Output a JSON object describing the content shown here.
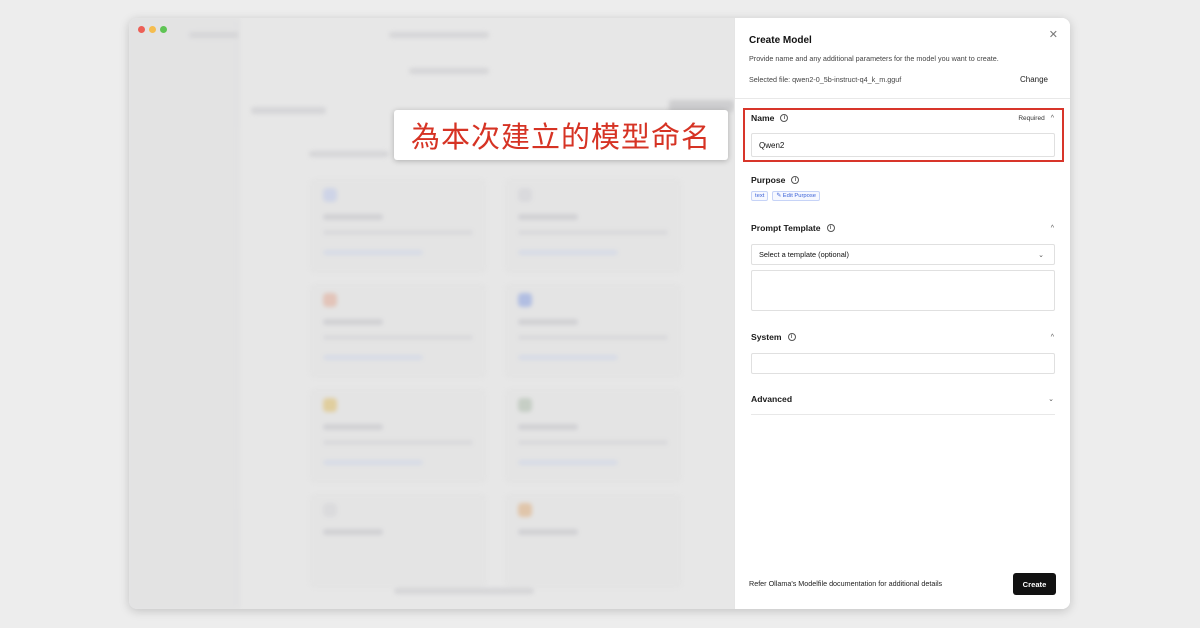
{
  "annotation": {
    "text": "為本次建立的模型命名",
    "color": "#d63324"
  },
  "panel": {
    "title": "Create Model",
    "description": "Provide name and any additional parameters for the model you want to create.",
    "selected_file": "Selected file: qwen2-0_5b-instruct-q4_k_m.gguf",
    "change_label": "Change",
    "close_icon": "close-icon"
  },
  "name_section": {
    "label": "Name",
    "required": "Required",
    "value": "Qwen2"
  },
  "purpose_section": {
    "label": "Purpose",
    "tags": [
      "text",
      "✎ Edit Purpose"
    ]
  },
  "prompt_template": {
    "label": "Prompt Template",
    "select_placeholder": "Select a template (optional)"
  },
  "system_section": {
    "label": "System"
  },
  "advanced_section": {
    "label": "Advanced"
  },
  "footer": {
    "note": "Refer Ollama's Modelfile documentation for additional details",
    "create_label": "Create"
  },
  "colors": {
    "highlight": "#d8352a",
    "accent_blue": "#3d63d8",
    "button": "#111111"
  }
}
